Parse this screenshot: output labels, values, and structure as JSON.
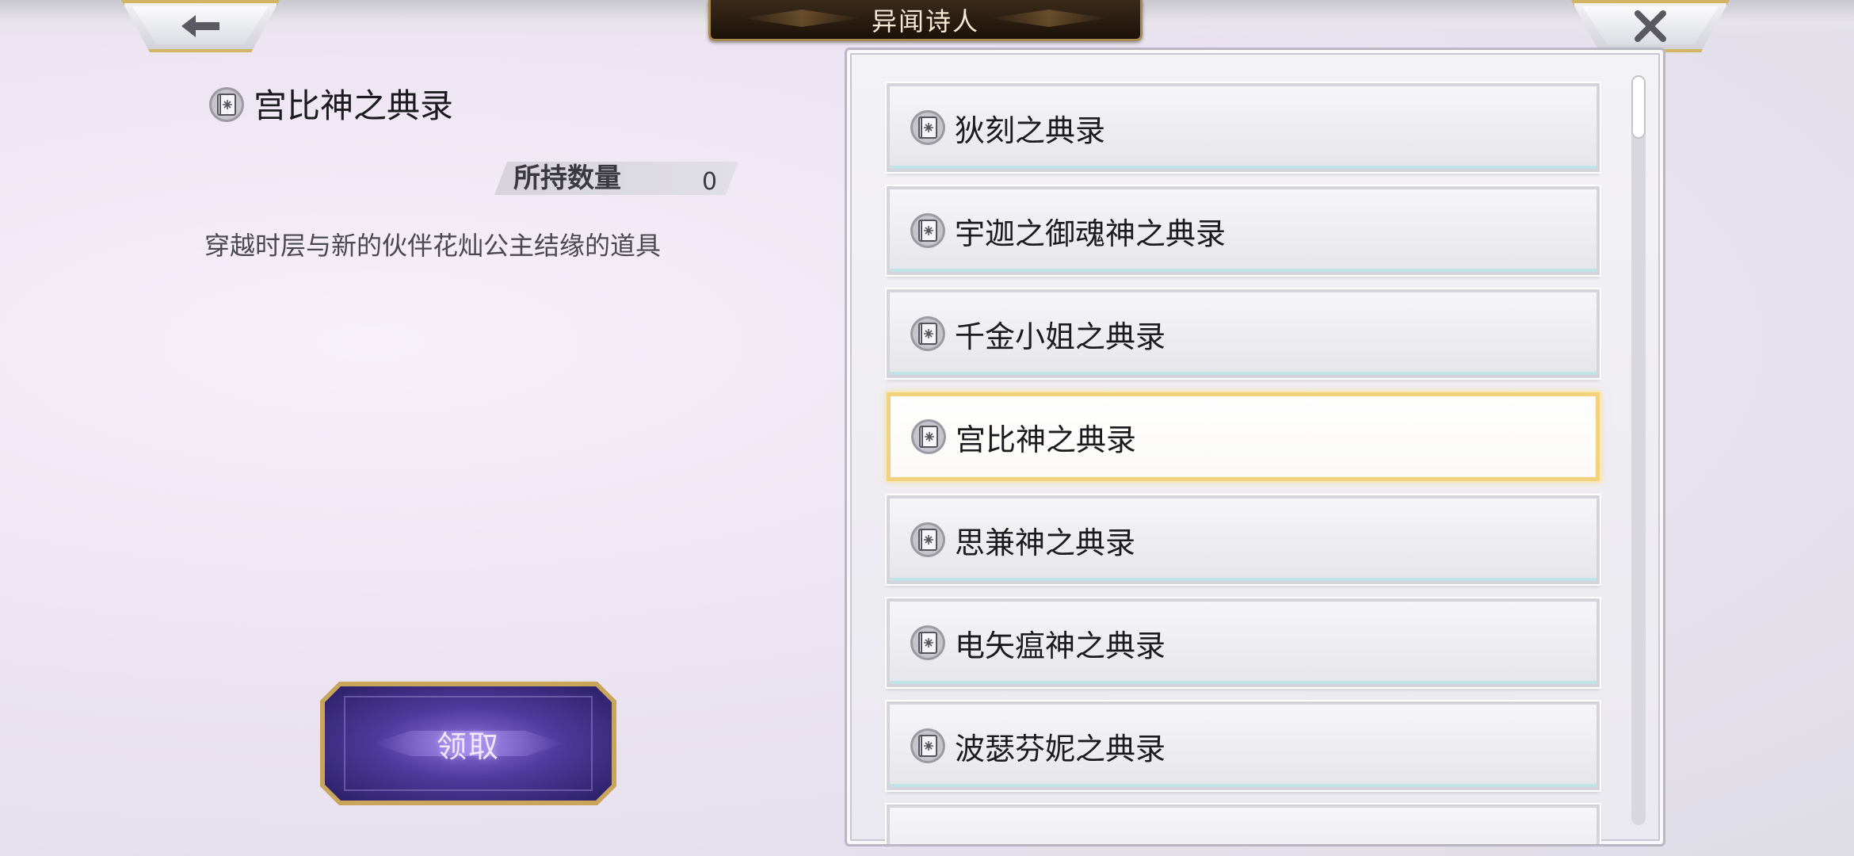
{
  "header": {
    "title": "异闻诗人",
    "back_icon": "arrow-left-icon",
    "close_icon": "close-icon"
  },
  "detail": {
    "icon": "tome-icon",
    "name": "宫比神之典录",
    "quantity_label": "所持数量",
    "quantity_value": "0",
    "description": "穿越时层与新的伙伴花灿公主结缘的道具"
  },
  "actions": {
    "claim_label": "领取"
  },
  "list": {
    "items": [
      {
        "label": "狄刻之典录",
        "selected": false
      },
      {
        "label": "宇迦之御魂神之典录",
        "selected": false
      },
      {
        "label": "千金小姐之典录",
        "selected": false
      },
      {
        "label": "宫比神之典录",
        "selected": true
      },
      {
        "label": "思兼神之典录",
        "selected": false
      },
      {
        "label": "电矢瘟神之典录",
        "selected": false
      },
      {
        "label": "波瑟芬妮之典录",
        "selected": false
      },
      {
        "label": "",
        "selected": false
      }
    ]
  },
  "colors": {
    "gold_border": "#d3b465",
    "selected_border": "#f2d27c",
    "claim_button": "#4d3a9c"
  }
}
